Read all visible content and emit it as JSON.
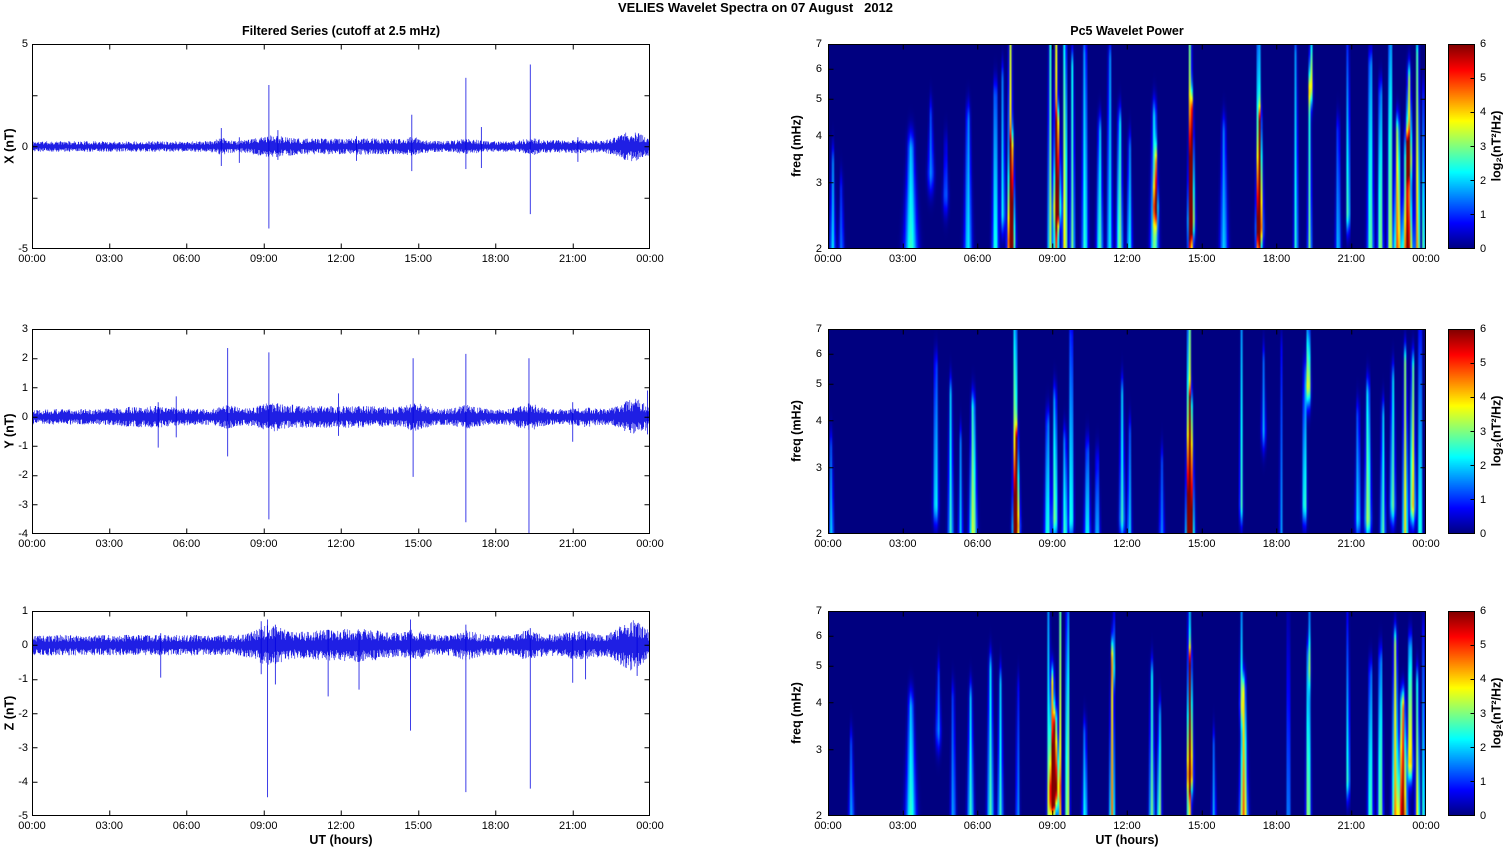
{
  "figure": {
    "title": "VELIES Wavelet Spectra on 07 August   2012"
  },
  "time_axis": {
    "ticks": [
      "00:00",
      "03:00",
      "06:00",
      "09:00",
      "12:00",
      "15:00",
      "18:00",
      "21:00",
      "00:00"
    ]
  },
  "colorbar": {
    "label": "log₂(nT²/Hz)",
    "ticks": [
      "6",
      "5",
      "4",
      "3",
      "2",
      "1",
      "0"
    ],
    "min": 0,
    "max": 6,
    "colormap": "jet"
  },
  "chart_data": [
    {
      "id": "x_filtered_series",
      "type": "line",
      "title": "Filtered Series (cutoff at 2.5 mHz)",
      "xlabel": "UT (hours)",
      "ylabel": "X (nT)",
      "line_color": "#0000e0",
      "xlim_hours": [
        0,
        24
      ],
      "ylim": [
        -5,
        5
      ],
      "yticks": [
        {
          "v": 5,
          "label": "5"
        },
        {
          "v": 2.5,
          "label": ""
        },
        {
          "v": 0,
          "label": "0"
        },
        {
          "v": -2.5,
          "label": ""
        },
        {
          "v": -5,
          "label": "-5"
        }
      ],
      "noise_base_nT": 0.26,
      "noise_bumps": [
        [
          7.4,
          0.3,
          0.6
        ],
        [
          9.3,
          0.8,
          0.9
        ],
        [
          11.0,
          1.8,
          0.45
        ],
        [
          13.5,
          1.5,
          0.45
        ],
        [
          14.8,
          0.4,
          0.6
        ],
        [
          16.9,
          0.5,
          0.5
        ],
        [
          19.4,
          0.4,
          0.6
        ],
        [
          21.0,
          1.0,
          0.3
        ],
        [
          23.3,
          0.7,
          1.8
        ]
      ],
      "spikes": [
        [
          7.35,
          0.9,
          -0.95
        ],
        [
          8.05,
          0.45,
          -0.8
        ],
        [
          9.2,
          3.0,
          -4.0
        ],
        [
          9.55,
          0.8,
          -0.65
        ],
        [
          12.6,
          0.5,
          -0.7
        ],
        [
          14.75,
          1.55,
          -1.2
        ],
        [
          16.85,
          3.35,
          -1.1
        ],
        [
          17.45,
          0.95,
          -1.05
        ],
        [
          19.35,
          4.0,
          -3.3
        ],
        [
          21.2,
          0.45,
          -0.75
        ]
      ]
    },
    {
      "id": "y_filtered_series",
      "type": "line",
      "title": "Filtered Series (cutoff at 2.5 mHz)",
      "xlabel": "UT (hours)",
      "ylabel": "Y (nT)",
      "line_color": "#0000e0",
      "xlim_hours": [
        0,
        24
      ],
      "ylim": [
        -4,
        3
      ],
      "yticks": [
        {
          "v": 3,
          "label": "3"
        },
        {
          "v": 2,
          "label": "2"
        },
        {
          "v": 1,
          "label": "1"
        },
        {
          "v": 0,
          "label": "0"
        },
        {
          "v": -1,
          "label": "-1"
        },
        {
          "v": -2,
          "label": "-2"
        },
        {
          "v": -3,
          "label": "-3"
        },
        {
          "v": -4,
          "label": "-4"
        }
      ],
      "noise_base_nT": 0.27,
      "noise_bumps": [
        [
          4.5,
          1.2,
          0.4
        ],
        [
          7.6,
          0.4,
          0.5
        ],
        [
          9.3,
          0.7,
          0.6
        ],
        [
          10.5,
          1.5,
          0.4
        ],
        [
          13.0,
          1.5,
          0.35
        ],
        [
          14.9,
          0.5,
          0.7
        ],
        [
          16.9,
          0.5,
          0.5
        ],
        [
          19.3,
          0.5,
          0.7
        ],
        [
          21.5,
          0.4,
          0.3
        ],
        [
          23.4,
          0.6,
          1.3
        ]
      ],
      "spikes": [
        [
          4.9,
          0.5,
          -1.05
        ],
        [
          5.6,
          0.7,
          -0.7
        ],
        [
          7.6,
          2.35,
          -1.35
        ],
        [
          9.2,
          2.2,
          -3.5
        ],
        [
          11.9,
          0.8,
          -0.65
        ],
        [
          14.8,
          2.0,
          -2.05
        ],
        [
          16.85,
          2.15,
          -3.6
        ],
        [
          19.3,
          2.0,
          -4.0
        ],
        [
          21.0,
          0.5,
          -0.85
        ],
        [
          23.9,
          0.9,
          -0.6
        ]
      ]
    },
    {
      "id": "z_filtered_series",
      "type": "line",
      "title": "Filtered Series (cutoff at 2.5 mHz)",
      "xlabel": "UT (hours)",
      "ylabel": "Z (nT)",
      "line_color": "#0000e0",
      "xlim_hours": [
        0,
        24
      ],
      "ylim": [
        -5,
        1
      ],
      "yticks": [
        {
          "v": 1,
          "label": "1"
        },
        {
          "v": 0,
          "label": "0"
        },
        {
          "v": -1,
          "label": "-1"
        },
        {
          "v": -2,
          "label": "-2"
        },
        {
          "v": -3,
          "label": "-3"
        },
        {
          "v": -4,
          "label": "-4"
        },
        {
          "v": -5,
          "label": "-5"
        }
      ],
      "noise_base_nT": 0.3,
      "noise_bumps": [
        [
          9.2,
          0.7,
          0.9
        ],
        [
          11.5,
          1.5,
          0.45
        ],
        [
          13.0,
          1.0,
          0.45
        ],
        [
          14.8,
          0.5,
          0.5
        ],
        [
          16.9,
          0.4,
          0.5
        ],
        [
          19.3,
          0.4,
          0.5
        ],
        [
          21.3,
          0.8,
          0.4
        ],
        [
          23.3,
          0.6,
          1.5
        ]
      ],
      "spikes": [
        [
          5.0,
          0.35,
          -0.95
        ],
        [
          8.9,
          0.7,
          -0.85
        ],
        [
          9.15,
          0.75,
          -4.45
        ],
        [
          9.45,
          0.6,
          -1.15
        ],
        [
          11.5,
          0.45,
          -1.5
        ],
        [
          12.7,
          0.4,
          -1.3
        ],
        [
          14.7,
          0.75,
          -2.5
        ],
        [
          16.85,
          0.6,
          -4.3
        ],
        [
          19.35,
          0.5,
          -4.2
        ],
        [
          21.0,
          0.35,
          -1.1
        ],
        [
          21.5,
          0.4,
          -1.0
        ],
        [
          23.5,
          0.6,
          -0.9
        ]
      ]
    },
    {
      "id": "x_wavelet_power",
      "type": "heatmap",
      "title": "Pc5 Wavelet Power",
      "xlabel": "UT (hours)",
      "ylabel": "freq (mHz)",
      "xlim_hours": [
        0,
        24
      ],
      "flim_mHz": [
        2,
        7
      ],
      "yscale": "log",
      "fticks": [
        7,
        6,
        5,
        4,
        3,
        2
      ],
      "zlim": [
        0,
        6
      ],
      "z_units": "log₂(nT²/Hz)",
      "colormap": "jet",
      "events_t_sigmat_flo_fhi_amp": [
        [
          0.15,
          0.1,
          2.0,
          3.3,
          2.2
        ],
        [
          0.5,
          0.1,
          2.0,
          2.8,
          1.5
        ],
        [
          3.3,
          0.25,
          2.0,
          3.6,
          2.6
        ],
        [
          4.1,
          0.12,
          3.2,
          4.4,
          1.6
        ],
        [
          4.7,
          0.1,
          2.8,
          3.6,
          1.4
        ],
        [
          5.6,
          0.15,
          2.0,
          4.3,
          2.2
        ],
        [
          6.7,
          0.12,
          2.0,
          5.0,
          2.6
        ],
        [
          7.0,
          0.08,
          2.5,
          5.5,
          2.4
        ],
        [
          7.3,
          0.1,
          2.0,
          7.1,
          4.6
        ],
        [
          7.35,
          0.13,
          2.1,
          3.6,
          5.3
        ],
        [
          8.9,
          0.09,
          2.0,
          7.0,
          3.4
        ],
        [
          9.15,
          0.09,
          2.0,
          7.1,
          4.8
        ],
        [
          9.2,
          0.12,
          2.6,
          4.2,
          5.4
        ],
        [
          9.5,
          0.09,
          2.0,
          7.0,
          4.3
        ],
        [
          9.8,
          0.09,
          2.0,
          6.0,
          3.0
        ],
        [
          10.3,
          0.12,
          2.0,
          6.5,
          2.6
        ],
        [
          10.9,
          0.12,
          2.0,
          4.0,
          2.8
        ],
        [
          11.3,
          0.1,
          2.0,
          6.3,
          2.4
        ],
        [
          11.7,
          0.12,
          2.0,
          4.2,
          3.2
        ],
        [
          12.1,
          0.1,
          2.0,
          3.6,
          2.4
        ],
        [
          13.1,
          0.15,
          2.0,
          4.4,
          3.0
        ],
        [
          13.15,
          0.08,
          2.6,
          3.3,
          4.3
        ],
        [
          14.55,
          0.08,
          2.0,
          7.1,
          5.0
        ],
        [
          14.6,
          0.11,
          2.4,
          4.6,
          5.6
        ],
        [
          15.9,
          0.15,
          2.0,
          4.0,
          2.0
        ],
        [
          17.3,
          0.09,
          2.0,
          7.0,
          4.4
        ],
        [
          17.35,
          0.12,
          2.3,
          4.2,
          5.3
        ],
        [
          18.8,
          0.08,
          2.0,
          6.5,
          2.6
        ],
        [
          19.35,
          0.08,
          2.0,
          5.0,
          3.0
        ],
        [
          19.4,
          0.07,
          5.5,
          7.1,
          4.2
        ],
        [
          20.5,
          0.1,
          2.0,
          4.0,
          2.0
        ],
        [
          20.9,
          0.06,
          2.5,
          7.1,
          3.4
        ],
        [
          21.8,
          0.12,
          2.0,
          6.0,
          3.0
        ],
        [
          22.2,
          0.1,
          2.0,
          5.0,
          3.4
        ],
        [
          22.6,
          0.1,
          2.0,
          6.9,
          3.8
        ],
        [
          22.9,
          0.12,
          2.0,
          4.0,
          5.0
        ],
        [
          23.3,
          0.18,
          2.0,
          3.6,
          6.3
        ],
        [
          23.35,
          0.12,
          3.5,
          5.5,
          4.4
        ],
        [
          23.7,
          0.08,
          2.0,
          6.5,
          4.6
        ],
        [
          23.95,
          0.06,
          2.0,
          5.0,
          3.5
        ]
      ]
    },
    {
      "id": "y_wavelet_power",
      "type": "heatmap",
      "title": "Pc5 Wavelet Power",
      "xlabel": "UT (hours)",
      "ylabel": "freq (mHz)",
      "xlim_hours": [
        0,
        24
      ],
      "flim_mHz": [
        2,
        7
      ],
      "yscale": "log",
      "fticks": [
        7,
        6,
        5,
        4,
        3,
        2
      ],
      "zlim": [
        0,
        6
      ],
      "z_units": "log₂(nT²/Hz)",
      "colormap": "jet",
      "events_t_sigmat_flo_fhi_amp": [
        [
          0.1,
          0.08,
          2.0,
          3.3,
          2.2
        ],
        [
          4.3,
          0.1,
          2.4,
          5.4,
          2.4
        ],
        [
          4.9,
          0.1,
          2.0,
          4.6,
          2.6
        ],
        [
          5.3,
          0.08,
          2.0,
          3.4,
          2.0
        ],
        [
          5.8,
          0.14,
          2.0,
          4.2,
          3.6
        ],
        [
          7.5,
          0.09,
          2.0,
          7.1,
          4.8
        ],
        [
          7.55,
          0.12,
          2.1,
          3.4,
          5.2
        ],
        [
          8.8,
          0.12,
          2.0,
          3.8,
          2.6
        ],
        [
          9.1,
          0.1,
          2.2,
          4.4,
          3.2
        ],
        [
          9.5,
          0.1,
          2.0,
          3.4,
          2.8
        ],
        [
          9.75,
          0.09,
          2.2,
          6.6,
          2.8
        ],
        [
          10.4,
          0.12,
          2.0,
          3.2,
          2.4
        ],
        [
          10.8,
          0.1,
          2.0,
          3.0,
          2.0
        ],
        [
          11.8,
          0.1,
          2.2,
          4.6,
          2.6
        ],
        [
          12.1,
          0.08,
          2.0,
          3.6,
          2.2
        ],
        [
          13.4,
          0.1,
          2.0,
          3.0,
          1.6
        ],
        [
          14.5,
          0.1,
          2.0,
          7.1,
          5.2
        ],
        [
          14.55,
          0.13,
          2.0,
          4.2,
          6.3
        ],
        [
          16.6,
          0.06,
          2.4,
          7.0,
          2.8
        ],
        [
          17.5,
          0.08,
          3.8,
          5.6,
          1.8
        ],
        [
          18.2,
          0.05,
          2.0,
          6.0,
          2.0
        ],
        [
          19.15,
          0.08,
          2.4,
          5.2,
          3.0
        ],
        [
          19.3,
          0.08,
          5.0,
          7.1,
          4.4
        ],
        [
          21.3,
          0.1,
          2.2,
          4.0,
          2.2
        ],
        [
          21.7,
          0.12,
          2.2,
          4.6,
          3.4
        ],
        [
          22.3,
          0.1,
          2.0,
          4.0,
          2.8
        ],
        [
          22.7,
          0.1,
          2.4,
          5.0,
          3.0
        ],
        [
          23.2,
          0.1,
          2.0,
          5.6,
          4.0
        ],
        [
          23.5,
          0.1,
          2.4,
          5.4,
          4.2
        ],
        [
          23.8,
          0.08,
          2.0,
          7.0,
          3.0
        ]
      ]
    },
    {
      "id": "z_wavelet_power",
      "type": "heatmap",
      "title": "Pc5 Wavelet Power",
      "xlabel": "UT (hours)",
      "ylabel": "freq (mHz)",
      "xlim_hours": [
        0,
        24
      ],
      "flim_mHz": [
        2,
        7
      ],
      "yscale": "log",
      "fticks": [
        7,
        6,
        5,
        4,
        3,
        2
      ],
      "zlim": [
        0,
        6
      ],
      "z_units": "log₂(nT²/Hz)",
      "colormap": "jet",
      "events_t_sigmat_flo_fhi_amp": [
        [
          0.9,
          0.1,
          2.0,
          3.0,
          1.8
        ],
        [
          3.3,
          0.2,
          2.0,
          3.8,
          2.6
        ],
        [
          4.4,
          0.1,
          3.4,
          4.6,
          1.6
        ],
        [
          5.0,
          0.1,
          2.0,
          4.0,
          1.8
        ],
        [
          5.7,
          0.12,
          2.0,
          4.0,
          2.6
        ],
        [
          6.5,
          0.12,
          2.0,
          4.8,
          2.8
        ],
        [
          6.9,
          0.1,
          2.0,
          4.4,
          2.6
        ],
        [
          7.6,
          0.07,
          2.0,
          4.2,
          1.8
        ],
        [
          8.85,
          0.07,
          2.0,
          7.0,
          3.0
        ],
        [
          9.0,
          0.12,
          2.2,
          4.4,
          5.4
        ],
        [
          9.1,
          0.15,
          2.4,
          3.4,
          5.8
        ],
        [
          9.3,
          0.06,
          2.0,
          7.1,
          4.2
        ],
        [
          9.6,
          0.08,
          2.0,
          6.6,
          4.0
        ],
        [
          10.3,
          0.1,
          2.0,
          3.2,
          2.4
        ],
        [
          11.4,
          0.09,
          2.0,
          5.2,
          4.6
        ],
        [
          11.45,
          0.05,
          5.0,
          7.1,
          2.6
        ],
        [
          13.0,
          0.1,
          2.0,
          4.6,
          3.0
        ],
        [
          13.3,
          0.08,
          2.0,
          3.6,
          3.4
        ],
        [
          14.5,
          0.07,
          2.0,
          7.1,
          4.6
        ],
        [
          14.55,
          0.1,
          2.6,
          5.0,
          5.6
        ],
        [
          15.5,
          0.08,
          2.0,
          3.0,
          1.8
        ],
        [
          16.6,
          0.06,
          4.0,
          7.0,
          2.6
        ],
        [
          16.7,
          0.14,
          2.0,
          4.2,
          4.8
        ],
        [
          18.5,
          0.06,
          2.0,
          6.5,
          2.2
        ],
        [
          19.3,
          0.09,
          2.0,
          5.2,
          3.6
        ],
        [
          19.35,
          0.05,
          5.0,
          7.0,
          2.0
        ],
        [
          20.9,
          0.05,
          2.5,
          7.1,
          3.6
        ],
        [
          21.8,
          0.1,
          2.0,
          4.6,
          3.0
        ],
        [
          22.2,
          0.1,
          2.0,
          5.0,
          3.4
        ],
        [
          22.8,
          0.12,
          2.0,
          5.6,
          4.4
        ],
        [
          23.1,
          0.16,
          2.0,
          3.8,
          6.3
        ],
        [
          23.4,
          0.1,
          2.8,
          5.4,
          4.6
        ],
        [
          23.7,
          0.08,
          2.0,
          4.4,
          4.0
        ],
        [
          23.95,
          0.06,
          2.0,
          6.0,
          3.2
        ]
      ]
    }
  ]
}
